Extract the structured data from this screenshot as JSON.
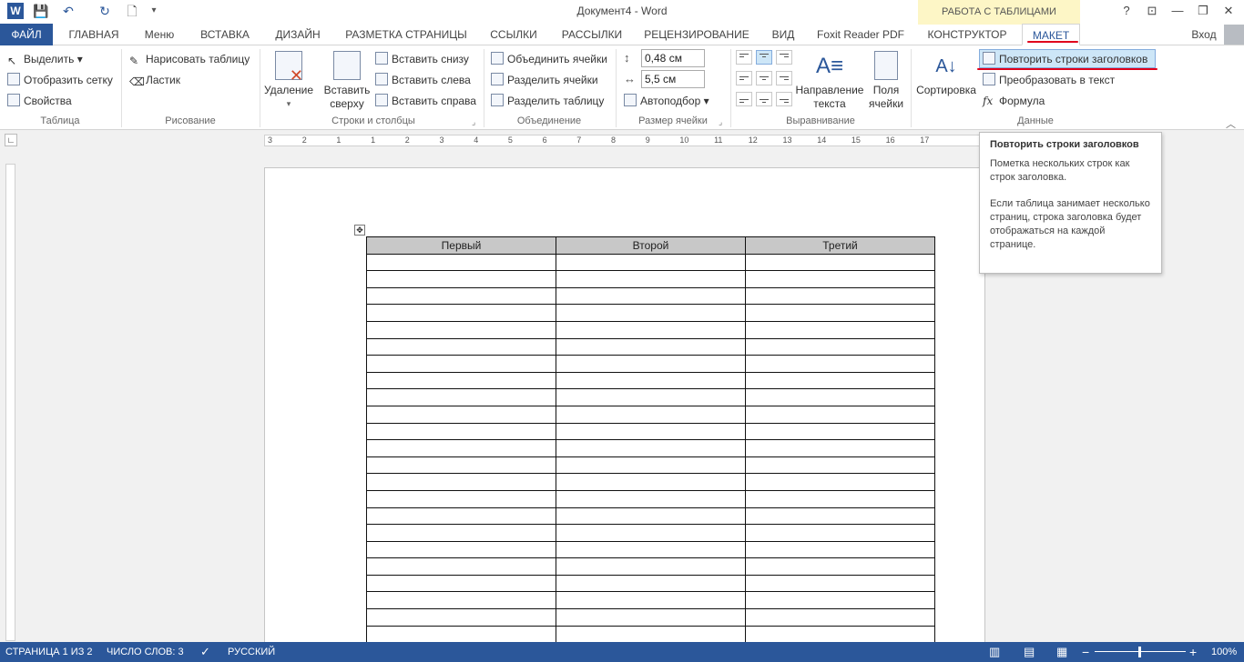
{
  "titlebar": {
    "doc_title": "Документ4 - Word",
    "context_group": "РАБОТА С ТАБЛИЦАМИ",
    "help": "?",
    "restore_ribbon": "⊡",
    "minimize": "—",
    "maximize": "❐",
    "close": "✕"
  },
  "quick_access": {
    "save": "💾",
    "undo": "↶",
    "redo": "↻",
    "new": "🗋",
    "more": "▾"
  },
  "tabs": {
    "file": "ФАЙЛ",
    "home": "ГЛАВНАЯ",
    "menu": "Меню",
    "insert": "ВСТАВКА",
    "design": "ДИЗАЙН",
    "layout_page": "РАЗМЕТКА СТРАНИЦЫ",
    "refs": "ССЫЛКИ",
    "mailings": "РАССЫЛКИ",
    "review": "РЕЦЕНЗИРОВАНИЕ",
    "view": "ВИД",
    "foxit": "Foxit Reader PDF",
    "constructor": "КОНСТРУКТОР",
    "maket": "МАКЕТ",
    "signin": "Вход"
  },
  "ribbon": {
    "table": {
      "select": "Выделить",
      "gridlines": "Отобразить сетку",
      "properties": "Свойства",
      "label": "Таблица"
    },
    "draw": {
      "draw_table": "Нарисовать таблицу",
      "eraser": "Ластик",
      "label": "Рисование"
    },
    "rows_cols": {
      "delete": "Удаление",
      "insert_above_1": "Вставить",
      "insert_above_2": "сверху",
      "insert_below": "Вставить снизу",
      "insert_left": "Вставить слева",
      "insert_right": "Вставить справа",
      "label": "Строки и столбцы"
    },
    "merge": {
      "merge_cells": "Объединить ячейки",
      "split_cells": "Разделить ячейки",
      "split_table": "Разделить таблицу",
      "label": "Объединение"
    },
    "cell_size": {
      "height": "0,48 см",
      "width": "5,5 см",
      "autofit": "Автоподбор",
      "label": "Размер ячейки"
    },
    "alignment": {
      "text_direction_1": "Направление",
      "text_direction_2": "текста",
      "margins_1": "Поля",
      "margins_2": "ячейки",
      "label": "Выравнивание"
    },
    "data": {
      "sort": "Сортировка",
      "repeat_headers": "Повторить строки заголовков",
      "convert_text": "Преобразовать в текст",
      "formula": "Формула",
      "label": "Данные"
    }
  },
  "ruler": {
    "marks": [
      "3",
      "2",
      "1",
      "1",
      "2",
      "3",
      "4",
      "5",
      "6",
      "7",
      "8",
      "9",
      "10",
      "11",
      "12",
      "13",
      "14",
      "15",
      "16",
      "17"
    ]
  },
  "document": {
    "headers": [
      "Первый",
      "Второй",
      "Третий"
    ]
  },
  "tooltip": {
    "title": "Повторить строки заголовков",
    "line1": "Пометка нескольких строк как строк заголовка.",
    "line2": "Если таблица занимает несколько страниц, строка заголовка будет отображаться на каждой странице."
  },
  "status": {
    "page": "СТРАНИЦА 1 ИЗ 2",
    "words": "ЧИСЛО СЛОВ: 3",
    "language": "РУССКИЙ",
    "zoom": "100%",
    "zoom_minus": "−",
    "zoom_plus": "+"
  },
  "colors": {
    "accent": "#2b579a",
    "context_tab_bg": "#fdf6c6",
    "underline": "#e0001b"
  }
}
